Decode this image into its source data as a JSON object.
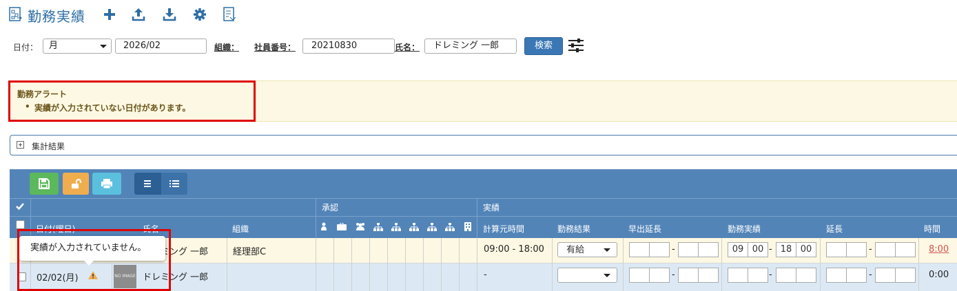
{
  "header": {
    "title": "勤務実績",
    "buttons": [
      "plus-icon",
      "upload-icon",
      "download-icon",
      "gear-icon",
      "export-icon"
    ]
  },
  "search": {
    "date_label": "日付：",
    "date_mode": "月",
    "date_value": "2026/02",
    "org_label": "組織：",
    "emp_no_label": "社員番号：",
    "emp_no_value": "20210830",
    "name_label": "氏名：",
    "name_value": "ドレミング 一郎",
    "search_button": "検索"
  },
  "alert": {
    "title": "勤務アラート",
    "items": [
      "実績が入力されていない日付があります。"
    ]
  },
  "summary": {
    "label": "集計結果"
  },
  "table": {
    "group_headers": {
      "approval": "承認",
      "actual": "実績"
    },
    "columns": {
      "date": "日付(曜日)",
      "name": "氏名",
      "org": "組織",
      "calc_time": "計算元時間",
      "work_result": "勤務結果",
      "early_extension": "早出延長",
      "work_actual": "勤務実績",
      "extension": "延長",
      "time": "時間"
    },
    "rows": [
      {
        "name": "ドレミング 一郎",
        "org": "経理部C",
        "calc_time": "09:00 - 18:00",
        "work_result": "有給",
        "actual_start_h": "09",
        "actual_start_m": "00",
        "actual_end_h": "18",
        "actual_end_m": "00",
        "time": "8:00",
        "dash": "-"
      },
      {
        "date": "02/02(月)",
        "name": "ドレミング 一郎",
        "avatar_text": "NO IMAGE",
        "calc_time": "-",
        "time": "0:00",
        "dash": "-"
      }
    ]
  },
  "tooltip": {
    "text": "実績が入力されていません。"
  },
  "colors": {
    "primary": "#3a77b4",
    "table_header": "#5284b8",
    "alert_bg": "#fcf8e3",
    "alert_text": "#6b5419",
    "highlight": "#e00000",
    "save": "#5cb85c",
    "unlock": "#f0ad4e",
    "print": "#5bc0de",
    "time_link": "#d9534f"
  }
}
